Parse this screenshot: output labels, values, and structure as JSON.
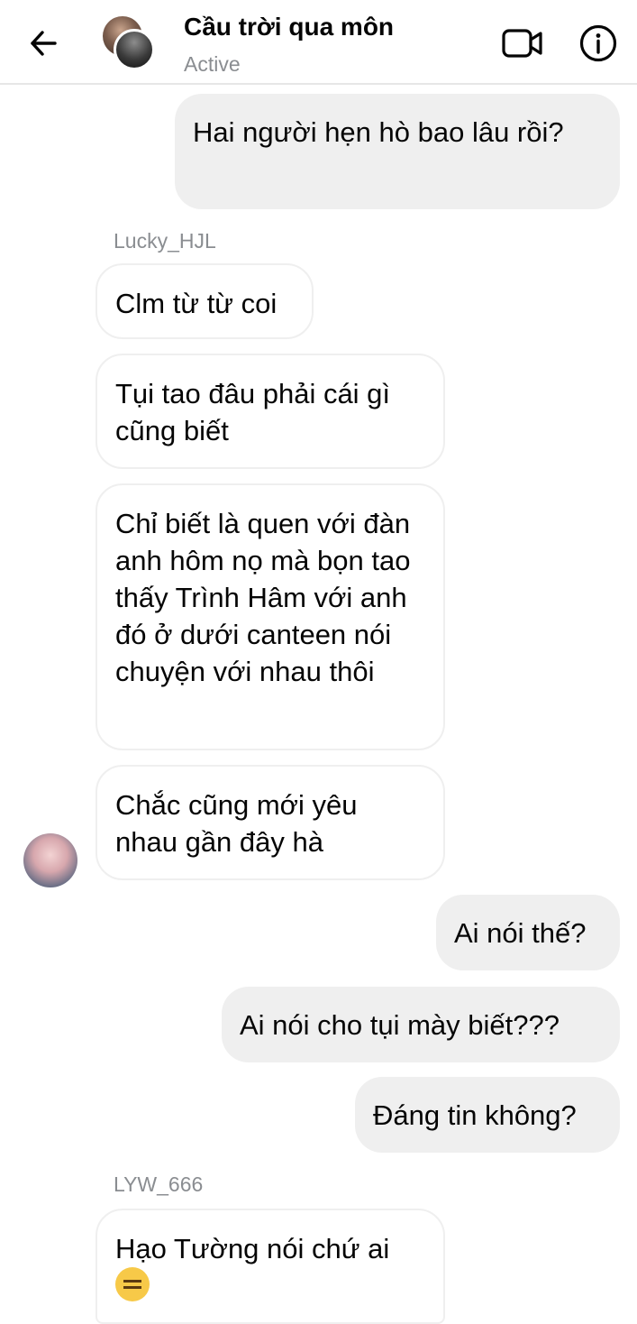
{
  "header": {
    "title": "Cầu trời qua môn",
    "status": "Active",
    "icons": {
      "back": "arrow-left-icon",
      "video": "video-camera-icon",
      "info": "info-icon"
    }
  },
  "messages": [
    {
      "direction": "outgoing",
      "text": "Hai người hẹn hò bao lâu rồi?"
    },
    {
      "direction": "incoming",
      "sender": "Lucky_HJL",
      "text": "Clm từ từ coi"
    },
    {
      "direction": "incoming",
      "text": "Tụi tao đâu phải cái gì cũng biết"
    },
    {
      "direction": "incoming",
      "text": "Chỉ biết là quen với đàn anh hôm nọ mà bọn tao thấy Trình Hâm với anh đó ở dưới canteen nói chuyện với nhau thôi"
    },
    {
      "direction": "incoming",
      "text": "Chắc cũng mới yêu nhau gần đây hà"
    },
    {
      "direction": "outgoing",
      "text": "Ai nói thế?"
    },
    {
      "direction": "outgoing",
      "text": "Ai nói cho tụi mày biết???"
    },
    {
      "direction": "outgoing",
      "text": "Đáng tin không?"
    },
    {
      "direction": "incoming",
      "sender": "LYW_666",
      "text": "Hạo Tường nói chứ ai",
      "emoji": "expressionless-face-emoji"
    }
  ],
  "colors": {
    "outgoing_bubble": "#efefef",
    "incoming_border": "#efefef",
    "secondary_text": "#8a8d91",
    "primary_text": "#050505"
  }
}
